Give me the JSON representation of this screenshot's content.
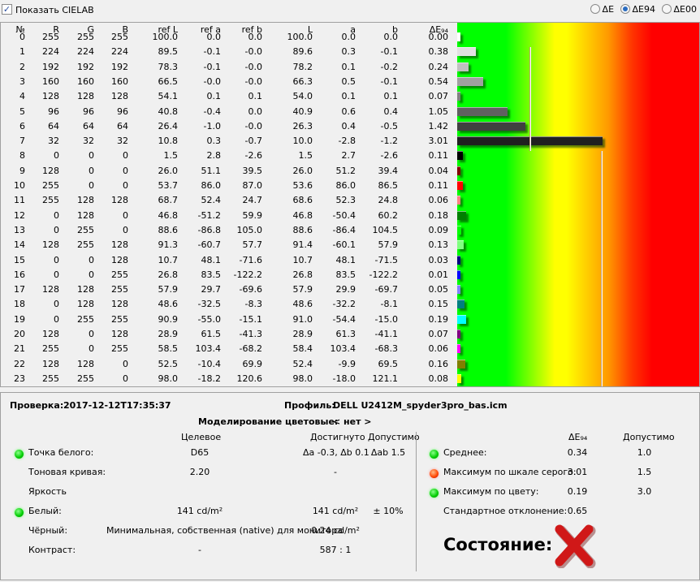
{
  "top": {
    "show_cielab": "Показать CIELAB",
    "radio": [
      "ΔE",
      "ΔE94",
      "ΔE00"
    ],
    "selected": "ΔE94"
  },
  "table": {
    "headers": [
      "№",
      "R",
      "G",
      "B",
      "ref L",
      "ref a",
      "ref b",
      "L",
      "a",
      "b",
      "ΔE₉₄"
    ],
    "rows": [
      [
        0,
        255,
        255,
        255,
        "100.0",
        "0.0",
        "0.0",
        "100.0",
        "0.0",
        "0.0",
        "0.00"
      ],
      [
        1,
        224,
        224,
        224,
        "89.5",
        "-0.1",
        "-0.0",
        "89.6",
        "0.3",
        "-0.1",
        "0.38"
      ],
      [
        2,
        192,
        192,
        192,
        "78.3",
        "-0.1",
        "-0.0",
        "78.2",
        "0.1",
        "-0.2",
        "0.24"
      ],
      [
        3,
        160,
        160,
        160,
        "66.5",
        "-0.0",
        "-0.0",
        "66.3",
        "0.5",
        "-0.1",
        "0.54"
      ],
      [
        4,
        128,
        128,
        128,
        "54.1",
        "0.1",
        "0.1",
        "54.0",
        "0.1",
        "0.1",
        "0.07"
      ],
      [
        5,
        96,
        96,
        96,
        "40.8",
        "-0.4",
        "0.0",
        "40.9",
        "0.6",
        "0.4",
        "1.05"
      ],
      [
        6,
        64,
        64,
        64,
        "26.4",
        "-1.0",
        "-0.0",
        "26.3",
        "0.4",
        "-0.5",
        "1.42"
      ],
      [
        7,
        32,
        32,
        32,
        "10.8",
        "0.3",
        "-0.7",
        "10.0",
        "-2.8",
        "-1.2",
        "3.01"
      ],
      [
        8,
        0,
        0,
        0,
        "1.5",
        "2.8",
        "-2.6",
        "1.5",
        "2.7",
        "-2.6",
        "0.11"
      ],
      [
        9,
        128,
        0,
        0,
        "26.0",
        "51.1",
        "39.5",
        "26.0",
        "51.2",
        "39.4",
        "0.04"
      ],
      [
        10,
        255,
        0,
        0,
        "53.7",
        "86.0",
        "87.0",
        "53.6",
        "86.0",
        "86.5",
        "0.11"
      ],
      [
        11,
        255,
        128,
        128,
        "68.7",
        "52.4",
        "24.7",
        "68.6",
        "52.3",
        "24.8",
        "0.06"
      ],
      [
        12,
        0,
        128,
        0,
        "46.8",
        "-51.2",
        "59.9",
        "46.8",
        "-50.4",
        "60.2",
        "0.18"
      ],
      [
        13,
        0,
        255,
        0,
        "88.6",
        "-86.8",
        "105.0",
        "88.6",
        "-86.4",
        "104.5",
        "0.09"
      ],
      [
        14,
        128,
        255,
        128,
        "91.3",
        "-60.7",
        "57.7",
        "91.4",
        "-60.1",
        "57.9",
        "0.13"
      ],
      [
        15,
        0,
        0,
        128,
        "10.7",
        "48.1",
        "-71.6",
        "10.7",
        "48.1",
        "-71.5",
        "0.03"
      ],
      [
        16,
        0,
        0,
        255,
        "26.8",
        "83.5",
        "-122.2",
        "26.8",
        "83.5",
        "-122.2",
        "0.01"
      ],
      [
        17,
        128,
        128,
        255,
        "57.9",
        "29.7",
        "-69.6",
        "57.9",
        "29.9",
        "-69.7",
        "0.05"
      ],
      [
        18,
        0,
        128,
        128,
        "48.6",
        "-32.5",
        "-8.3",
        "48.6",
        "-32.2",
        "-8.1",
        "0.15"
      ],
      [
        19,
        0,
        255,
        255,
        "90.9",
        "-55.0",
        "-15.1",
        "91.0",
        "-54.4",
        "-15.0",
        "0.19"
      ],
      [
        20,
        128,
        0,
        128,
        "28.9",
        "61.5",
        "-41.3",
        "28.9",
        "61.3",
        "-41.1",
        "0.07"
      ],
      [
        21,
        255,
        0,
        255,
        "58.5",
        "103.4",
        "-68.2",
        "58.4",
        "103.4",
        "-68.3",
        "0.06"
      ],
      [
        22,
        128,
        128,
        0,
        "52.5",
        "-10.4",
        "69.9",
        "52.4",
        "-9.9",
        "69.5",
        "0.16"
      ],
      [
        23,
        255,
        255,
        0,
        "98.0",
        "-18.2",
        "120.6",
        "98.0",
        "-18.0",
        "121.1",
        "0.08"
      ]
    ],
    "gray_tolerance": 1.5,
    "color_tolerance": 3.0
  },
  "summary": {
    "check_label": "Проверка:",
    "check_value": "2017-12-12T17:35:37",
    "profile_label": "Профиль:",
    "profile_value": "DELL U2412M_spyder3pro_bas.icm",
    "sim_label": "Моделирование цветовые:",
    "sim_value": "< нет >",
    "col_target": "Целевое",
    "col_achieved": "Достигнуто",
    "col_allowed": "Допустимо",
    "rows": [
      {
        "label": "Точка белого:",
        "target": "D65",
        "achieved": "Δa -0.3, Δb 0.1",
        "allowed": "Δab 1.5",
        "status": "green"
      },
      {
        "label": "Тоновая кривая:",
        "target": "2.20",
        "achieved": "-",
        "allowed": ""
      },
      {
        "label": "Яркость",
        "target": "",
        "achieved": "",
        "allowed": ""
      },
      {
        "label": "Белый:",
        "target": "141 cd/m²",
        "achieved": "141 cd/m²",
        "allowed": "± 10%",
        "status": "green"
      },
      {
        "label": "Чёрный:",
        "target": "Минимальная, собственная (native) для монитора",
        "achieved": "0.24 cd/m²",
        "allowed": ""
      },
      {
        "label": "Контраст:",
        "target": "-",
        "achieved": "587 : 1",
        "allowed": ""
      }
    ],
    "stats_col_de": "ΔE₉₄",
    "stats_col_allowed": "Допустимо",
    "stats": [
      {
        "label": "Среднее:",
        "value": "0.34",
        "allowed": "1.0",
        "status": "green"
      },
      {
        "label": "Максимум по шкале серого:",
        "value": "3.01",
        "allowed": "1.5",
        "status": "red"
      },
      {
        "label": "Максимум по цвету:",
        "value": "0.19",
        "allowed": "3.0",
        "status": "green"
      },
      {
        "label": "Стандартное отклонение:",
        "value": "0.65",
        "allowed": ""
      }
    ],
    "state_label": "Состояние:",
    "state": "fail"
  }
}
